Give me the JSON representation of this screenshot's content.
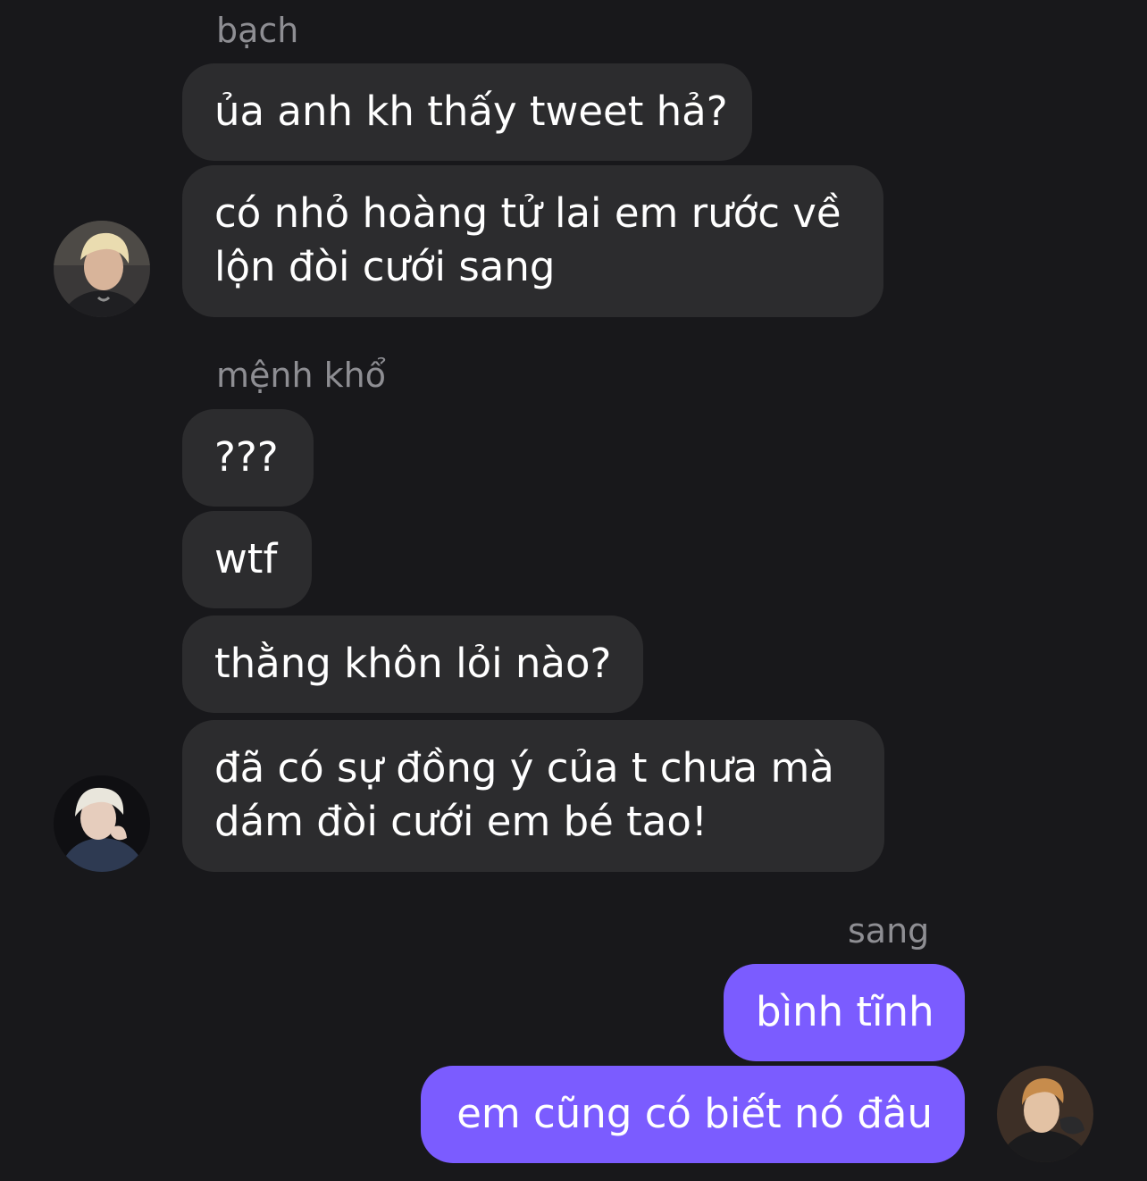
{
  "groups": [
    {
      "sender": "bạch",
      "messages": [
        {
          "lines": [
            "ủa anh kh thấy tweet hả?"
          ]
        },
        {
          "lines": [
            "có nhỏ hoàng tử lai em rước về",
            "lộn đòi cưới sang"
          ]
        }
      ]
    },
    {
      "sender": "mệnh khổ",
      "messages": [
        {
          "lines": [
            "???"
          ]
        },
        {
          "lines": [
            "wtf"
          ]
        },
        {
          "lines": [
            "thằng khôn lỏi nào?"
          ]
        },
        {
          "lines": [
            "đã có sự đồng ý của t chưa mà",
            "dám đòi cưới em bé tao!"
          ]
        }
      ]
    },
    {
      "sender": "sang",
      "messages": [
        {
          "lines": [
            "bình tĩnh"
          ]
        },
        {
          "lines": [
            "em cũng có biết nó đâu"
          ]
        }
      ]
    }
  ],
  "colors": {
    "background": "#18181b",
    "incoming_bubble": "#2c2c2e",
    "outgoing_bubble": "#7b5cff",
    "sender_label": "#8e8e93"
  }
}
